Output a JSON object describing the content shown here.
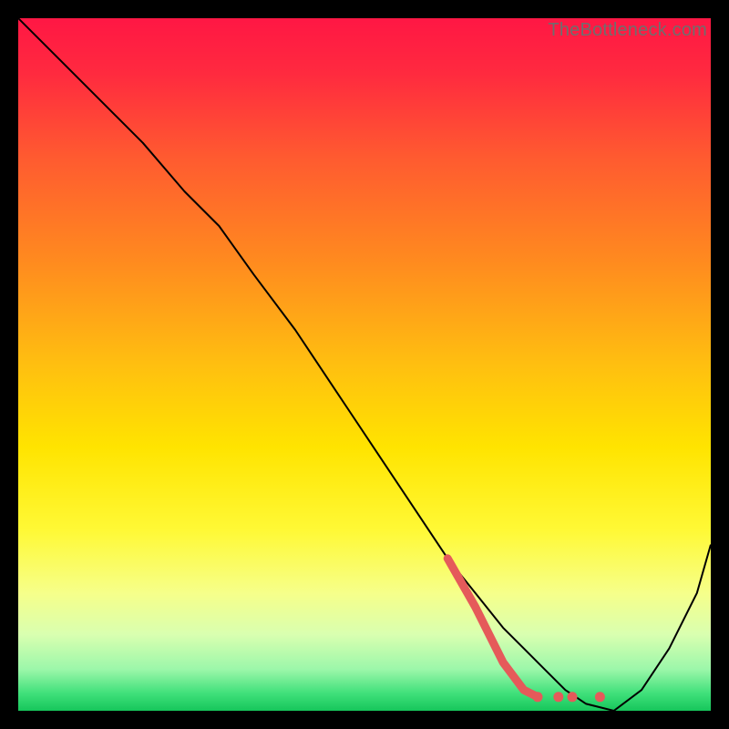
{
  "watermark": "TheBottleneck.com",
  "chart_data": {
    "type": "line",
    "title": "",
    "xlabel": "",
    "ylabel": "",
    "xlim": [
      0,
      100
    ],
    "ylim": [
      0,
      100
    ],
    "grid": false,
    "legend": false,
    "background_gradient_stops": [
      {
        "offset": 0.0,
        "color": "#ff1744"
      },
      {
        "offset": 0.08,
        "color": "#ff2a3f"
      },
      {
        "offset": 0.2,
        "color": "#ff5a30"
      },
      {
        "offset": 0.35,
        "color": "#ff8a1f"
      },
      {
        "offset": 0.5,
        "color": "#ffbf10"
      },
      {
        "offset": 0.62,
        "color": "#ffe400"
      },
      {
        "offset": 0.74,
        "color": "#fff936"
      },
      {
        "offset": 0.83,
        "color": "#f6ff8a"
      },
      {
        "offset": 0.89,
        "color": "#d9ffb0"
      },
      {
        "offset": 0.94,
        "color": "#9cf7aa"
      },
      {
        "offset": 0.975,
        "color": "#3fe07a"
      },
      {
        "offset": 1.0,
        "color": "#16c65b"
      }
    ],
    "series": [
      {
        "name": "bottleneck-curve",
        "stroke": "#000000",
        "stroke_width": 2,
        "x": [
          0,
          6,
          12,
          18,
          24,
          29,
          34,
          40,
          46,
          52,
          58,
          62,
          66,
          70,
          73,
          76,
          79,
          82,
          86,
          90,
          94,
          98,
          100
        ],
        "y": [
          100,
          94,
          88,
          82,
          75,
          70,
          63,
          55,
          46,
          37,
          28,
          22,
          17,
          12,
          9,
          6,
          3,
          1,
          0,
          3,
          9,
          17,
          24
        ]
      },
      {
        "name": "marker-path",
        "stroke": "#e55a5a",
        "stroke_width": 9,
        "linecap": "round",
        "x": [
          62,
          66,
          70,
          73,
          75
        ],
        "y": [
          22,
          15,
          7,
          3,
          2
        ]
      }
    ],
    "marker_dots": {
      "color": "#e55a5a",
      "radius": 5.5,
      "points": [
        {
          "x": 75,
          "y": 2
        },
        {
          "x": 78,
          "y": 2
        },
        {
          "x": 80,
          "y": 2
        },
        {
          "x": 84,
          "y": 2
        }
      ]
    }
  }
}
